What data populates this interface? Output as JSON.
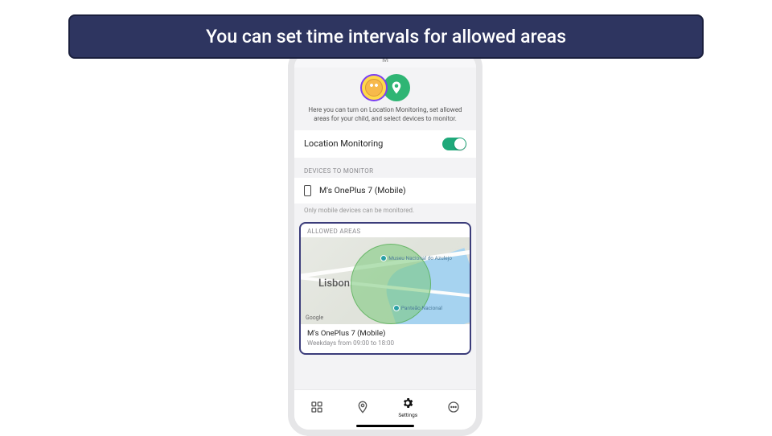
{
  "banner": {
    "text": "You can set time intervals for allowed areas"
  },
  "topbar": {
    "letter": "M"
  },
  "intro": {
    "description": "Here you can turn on Location Monitoring, set allowed areas for your child, and select devices to monitor."
  },
  "location_monitoring": {
    "label": "Location Monitoring",
    "enabled": true
  },
  "devices": {
    "section_label": "DEVICES TO MONITOR",
    "items": [
      {
        "name": "M's OnePlus 7 (Mobile)"
      }
    ],
    "hint": "Only mobile devices can be monitored."
  },
  "allowed_areas": {
    "section_label": "ALLOWED AREAS",
    "map": {
      "city": "Lisbon",
      "provider": "Google",
      "poi": [
        {
          "name": "Museu Nacional do Azulejo"
        },
        {
          "name": "Panteão Nacional"
        }
      ]
    },
    "area": {
      "title": "M's OnePlus 7 (Mobile)",
      "schedule": "Weekdays from 09:00 to 18:00"
    }
  },
  "nav": {
    "items": [
      {
        "id": "dashboard",
        "label": ""
      },
      {
        "id": "location",
        "label": ""
      },
      {
        "id": "settings",
        "label": "Settings"
      },
      {
        "id": "more",
        "label": ""
      }
    ]
  }
}
